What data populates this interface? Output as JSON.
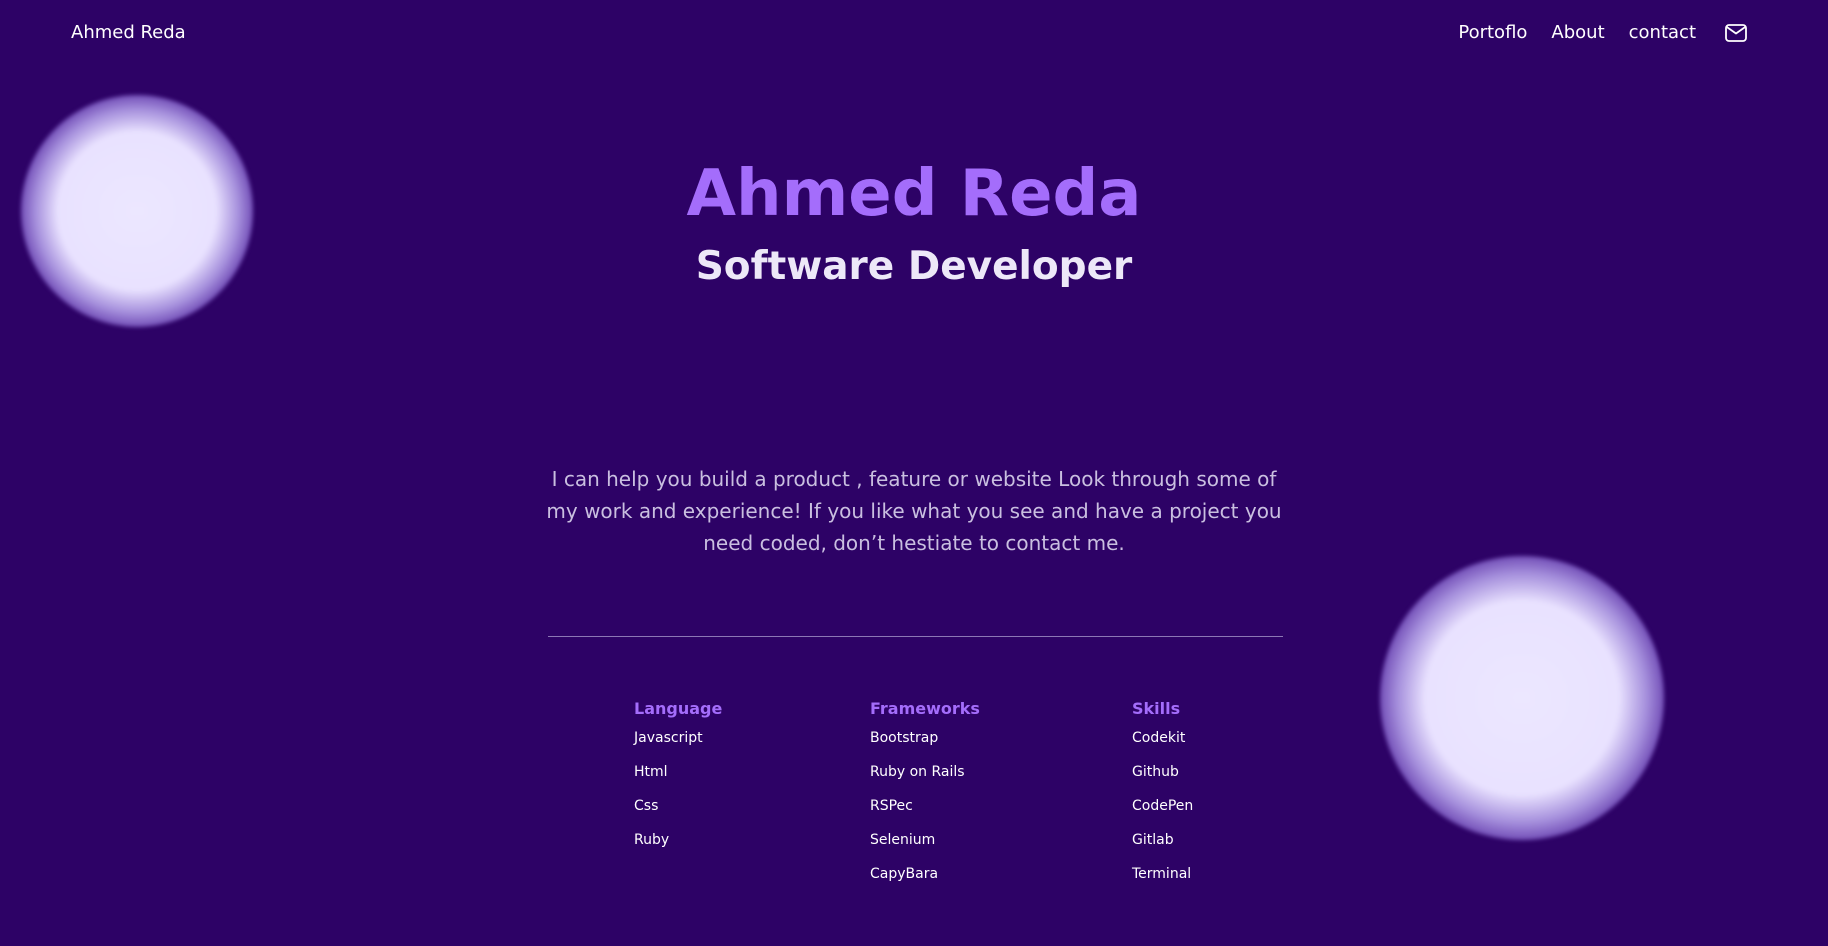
{
  "header": {
    "brand": "Ahmed Reda",
    "nav": [
      "Portoflo",
      "About",
      "contact"
    ],
    "mail_icon": "mail-icon"
  },
  "hero": {
    "name": "Ahmed Reda",
    "role": "Software Developer",
    "intro": "I can help you build a product , feature or website Look through some of my work and experience! If you like what you see and have a project you need coded, don’t hestiate to contact me."
  },
  "skills": {
    "language": {
      "title": "Language",
      "items": [
        "Javascript",
        "Html",
        "Css",
        "Ruby"
      ]
    },
    "frameworks": {
      "title": "Frameworks",
      "items": [
        "Bootstrap",
        "Ruby on Rails",
        "RSPec",
        "Selenium",
        "CapyBara"
      ]
    },
    "skills": {
      "title": "Skills",
      "items": [
        "Codekit",
        "Github",
        "CodePen",
        "Gitlab",
        "Terminal"
      ]
    }
  },
  "colors": {
    "background": "#2d0266",
    "accent": "#a46dfb",
    "heading_light": "#ede8f8",
    "body_text": "#c9bfe0"
  }
}
